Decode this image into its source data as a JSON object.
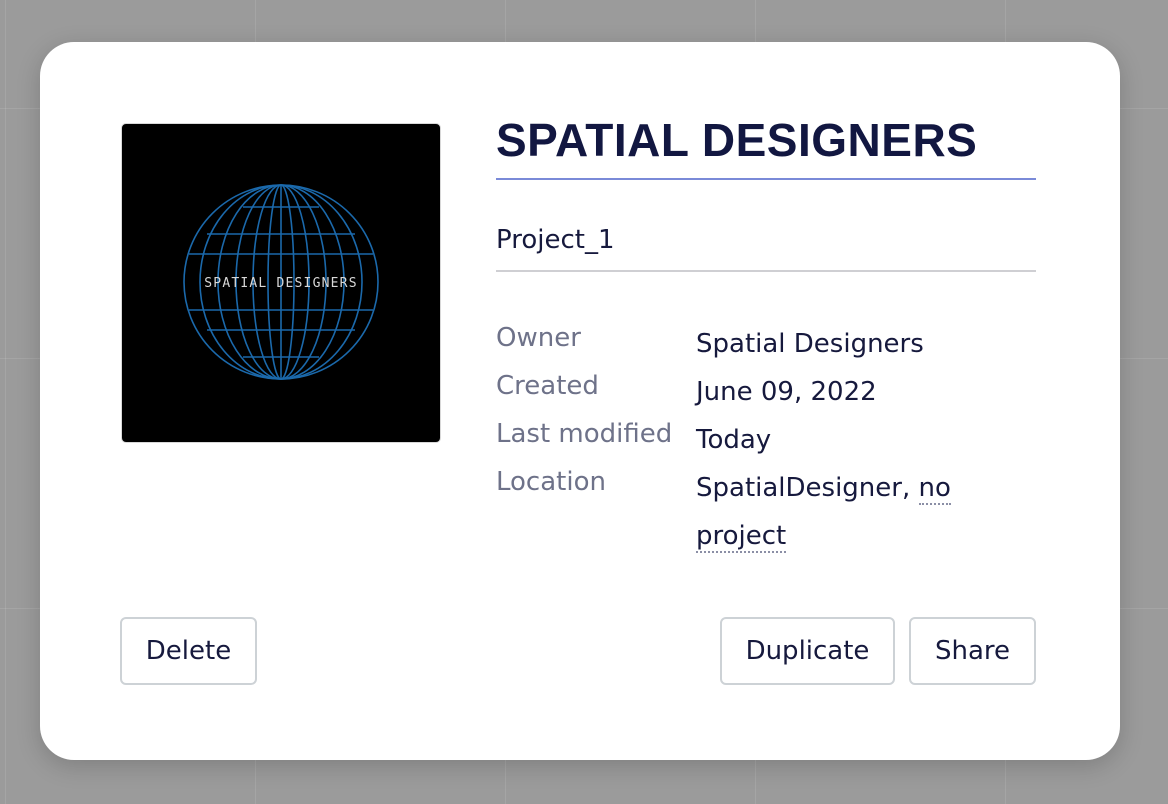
{
  "dialog": {
    "title": "SPATIAL DESIGNERS",
    "project_name": "Project_1",
    "thumbnail": {
      "logo_text": "SPATIAL DESIGNERS",
      "icon": "globe-wireframe-icon",
      "background_color": "#000000",
      "line_color": "#1d6fb5"
    },
    "details": {
      "owner_label": "Owner",
      "owner_value": "Spatial Designers",
      "created_label": "Created",
      "created_value": "June 09, 2022",
      "modified_label": "Last modified",
      "modified_value": "Today",
      "location_label": "Location",
      "location_value": "SpatialDesigner,",
      "location_link_part1": "no",
      "location_link_part2": "project"
    },
    "buttons": {
      "delete": "Delete",
      "duplicate": "Duplicate",
      "share": "Share"
    }
  }
}
